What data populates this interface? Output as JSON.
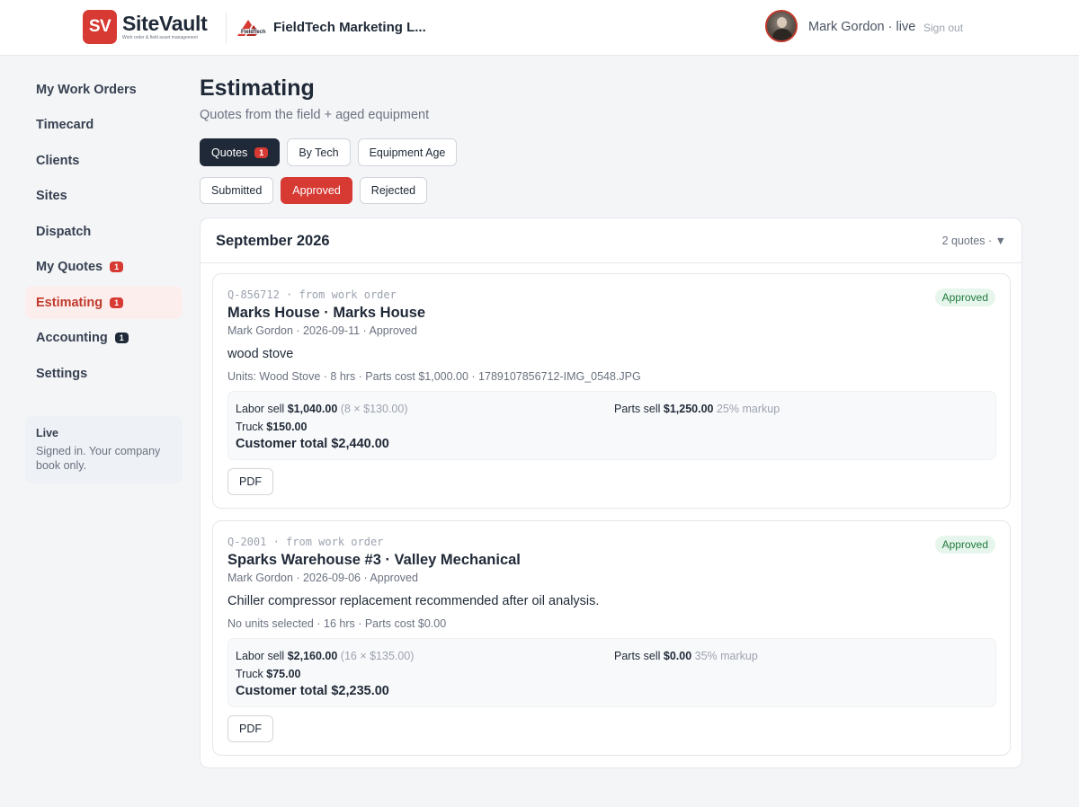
{
  "header": {
    "logo_mark": "SV",
    "app_name": "SiteVault",
    "app_tagline": "Work order & field asset management",
    "company_name": "FieldTech Marketing L...",
    "user_label": "Mark Gordon · live",
    "signout_label": "Sign out"
  },
  "sidebar": {
    "items": [
      {
        "label": "My Work Orders"
      },
      {
        "label": "Timecard"
      },
      {
        "label": "Clients"
      },
      {
        "label": "Sites"
      },
      {
        "label": "Dispatch"
      },
      {
        "label": "My Quotes",
        "badge": "1"
      },
      {
        "label": "Estimating",
        "badge": "1",
        "active": true
      },
      {
        "label": "Accounting",
        "badge": "1"
      },
      {
        "label": "Settings"
      }
    ],
    "live": {
      "title": "Live",
      "text": "Signed in. Your company book only."
    }
  },
  "main": {
    "title": "Estimating",
    "subtitle": "Quotes from the field + aged equipment",
    "tabs": [
      {
        "label": "Quotes",
        "badge": "1",
        "active": true
      },
      {
        "label": "By Tech"
      },
      {
        "label": "Equipment Age"
      }
    ],
    "filters": [
      {
        "label": "Submitted"
      },
      {
        "label": "Approved",
        "active": true
      },
      {
        "label": "Rejected"
      }
    ],
    "group": {
      "month": "September 2026",
      "count_label": "2 quotes · ▼"
    },
    "quotes": [
      {
        "meta": "Q-856712 · from work order",
        "status": "Approved",
        "title": "Marks House · Marks House",
        "sub": "Mark Gordon · 2026-09-11 · Approved",
        "desc": "wood stove",
        "units": "Units: Wood Stove · 8 hrs · Parts cost $1,000.00 · 1789107856712-IMG_0548.JPG",
        "labor_label": "Labor sell",
        "labor_value": "$1,040.00",
        "labor_detail": "(8 × $130.00)",
        "truck_label": "Truck",
        "truck_value": "$150.00",
        "total": "Customer total $2,440.00",
        "parts_label": "Parts sell",
        "parts_value": "$1,250.00",
        "parts_markup": "25% markup",
        "pdf_label": "PDF"
      },
      {
        "meta": "Q-2001 · from work order",
        "status": "Approved",
        "title": "Sparks Warehouse #3 · Valley Mechanical",
        "sub": "Mark Gordon · 2026-09-06 · Approved",
        "desc": "Chiller compressor replacement recommended after oil analysis.",
        "units": "No units selected · 16 hrs · Parts cost $0.00",
        "labor_label": "Labor sell",
        "labor_value": "$2,160.00",
        "labor_detail": "(16 × $135.00)",
        "truck_label": "Truck",
        "truck_value": "$75.00",
        "total": "Customer total $2,235.00",
        "parts_label": "Parts sell",
        "parts_value": "$0.00",
        "parts_markup": "35% markup",
        "pdf_label": "PDF"
      }
    ]
  },
  "colors": {
    "brand_red": "#d63a33",
    "dark": "#1f2937",
    "approved_bg": "#e7f6ec",
    "approved_text": "#1f7a3d"
  }
}
